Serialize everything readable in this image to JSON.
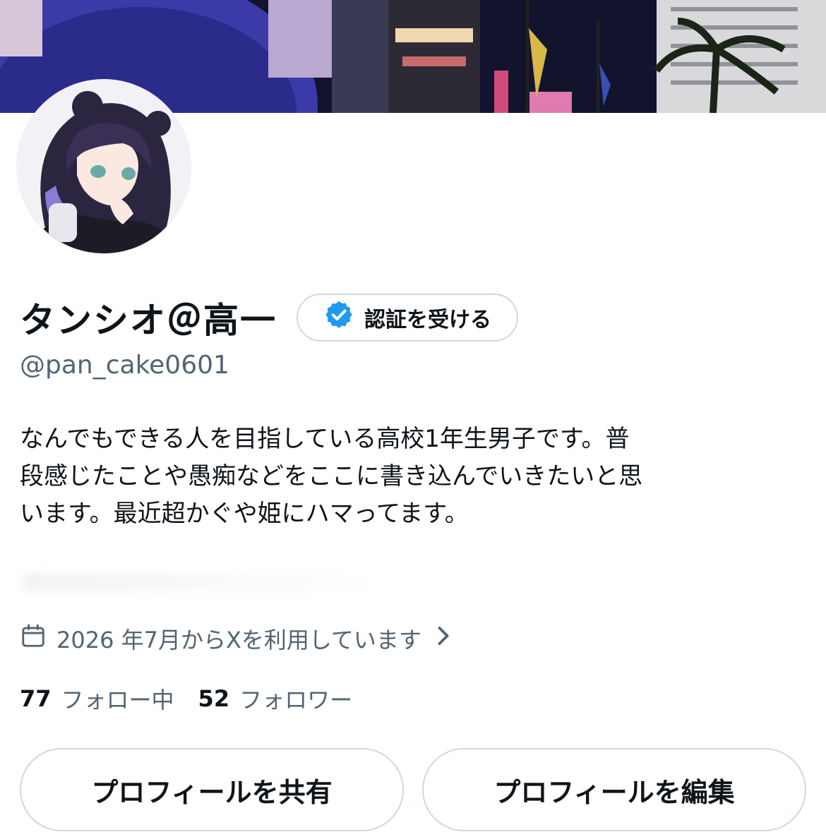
{
  "profile": {
    "display_name": "タンシオ＠高一",
    "handle": "@pan_cake0601",
    "verify_label": "認証を受ける",
    "bio": [
      "なんでもできる人を目指している高校1年生男子です。普",
      "段感じたことや愚痴などをここに書き込んでいきたいと思",
      "います。最近超かぐや姫にハマってます。"
    ],
    "joined": "2026 年7月からXを利用しています",
    "following_count": "77",
    "following_label": "フォロー中",
    "followers_count": "52",
    "followers_label": "フォロワー"
  },
  "actions": {
    "share_label": "プロフィールを共有",
    "edit_label": "プロフィールを編集"
  },
  "icons": {
    "verified": "verified-badge-icon",
    "calendar": "calendar-icon",
    "chevron": "chevron-right-icon"
  },
  "colors": {
    "verified_blue": "#1d9bf0",
    "secondary_text": "#536471",
    "border": "#cfd9de"
  }
}
